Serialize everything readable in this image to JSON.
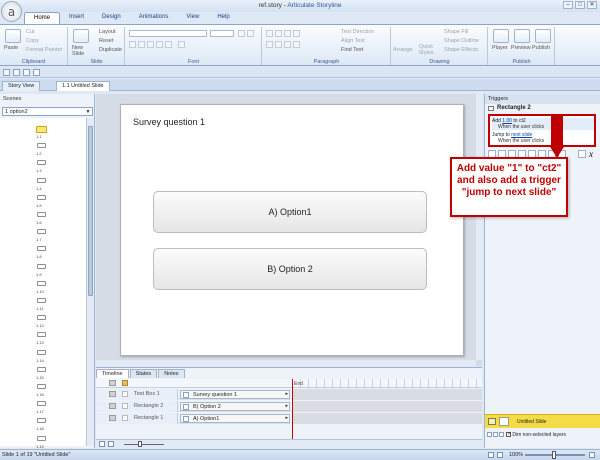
{
  "window": {
    "file_name": "ref.story",
    "separator": " - ",
    "app_name": "Articulate Storyline",
    "controls": [
      "–",
      "□",
      "✕"
    ],
    "logo_letter": "a"
  },
  "ribbon_tabs": [
    "Home",
    "Insert",
    "Design",
    "Animations",
    "View",
    "Help"
  ],
  "ribbon": {
    "clipboard": {
      "paste": "Paste",
      "cut": "Cut",
      "copy": "Copy",
      "format_painter": "Format Painter",
      "group": "Clipboard"
    },
    "slide": {
      "new_slide": "New Slide",
      "layout": "Layout",
      "reset": "Reset",
      "duplicate": "Duplicate",
      "group": "Slide"
    },
    "font": {
      "group": "Font"
    },
    "paragraph": {
      "text_direction": "Text Direction",
      "align_text": "Align Text",
      "find_text": "Find Text",
      "group": "Paragraph"
    },
    "drawing": {
      "arrange": "Arrange",
      "quick_styles": "Quick Styles",
      "shape_fill": "Shape Fill",
      "shape_outline": "Shape Outline",
      "shape_effects": "Shape Effects",
      "group": "Drawing"
    },
    "publish": {
      "player": "Player",
      "preview": "Preview",
      "publish": "Publish",
      "group": "Publish"
    }
  },
  "doc_tabs": [
    "Story View",
    "1.1 Untitled Slide"
  ],
  "scenes": {
    "title": "Scenes",
    "selected_scene": "1 option2",
    "slide_numbers": [
      "1.1",
      "1.2",
      "1.3",
      "1.4",
      "1.5",
      "1.6",
      "1.7",
      "1.8",
      "1.9",
      "1.10",
      "1.11",
      "1.12",
      "1.13",
      "1.14",
      "1.15",
      "1.16",
      "1.17",
      "1.18",
      "1.19"
    ]
  },
  "slide": {
    "title_text": "Survey question 1",
    "option_a": "A) Option1",
    "option_b": "B) Option 2"
  },
  "timeline": {
    "tabs": [
      "Timeline",
      "States",
      "Notes"
    ],
    "layers": [
      {
        "name": "Text Box 1",
        "bar": "Survey question 1"
      },
      {
        "name": "Rectangle 2",
        "bar": "B) Option 2"
      },
      {
        "name": "Rectangle 1",
        "bar": "A) Option1"
      }
    ],
    "end_label": "End"
  },
  "triggers": {
    "title": "Triggers",
    "object_name": "Rectangle 2",
    "items": [
      {
        "prefix": "Add ",
        "link": "1.00",
        "suffix": " to ct2",
        "sub": "When the user clicks"
      },
      {
        "prefix": "Jump to ",
        "link": "next slide",
        "suffix": "",
        "sub": "When the user clicks"
      }
    ]
  },
  "layers_panel": {
    "base_layer": "Untitled Slide",
    "dim_label": "Dim non-selected layers"
  },
  "callout": {
    "text": "Add value \"1\" to \"ct2\" and also add a trigger \"jump to next slide\"",
    "color": "#c00000"
  },
  "status": {
    "slide_info": "Slide 1 of 19    \"Untitled Slide\"",
    "zoom": "100%"
  }
}
